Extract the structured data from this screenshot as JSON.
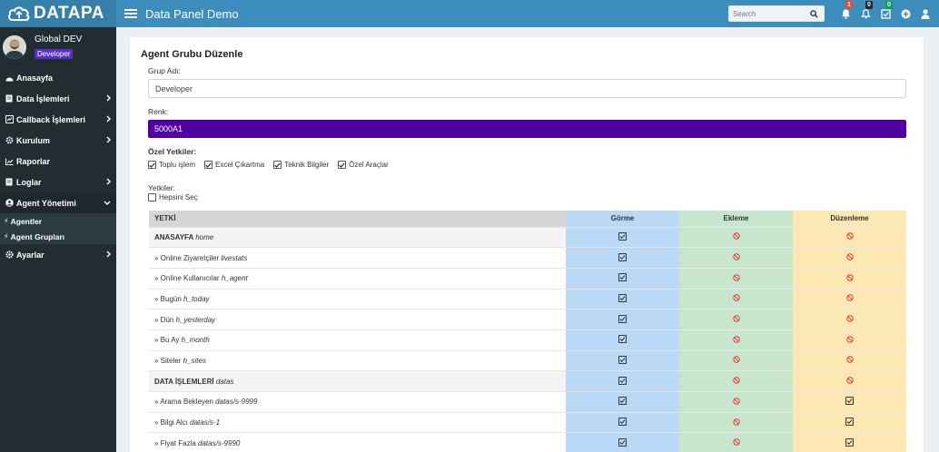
{
  "brand": {
    "logo_text": "DATAPA"
  },
  "header": {
    "title": "Data Panel Demo",
    "search_placeholder": "Search",
    "notifications_count": "1",
    "alerts_count": "0",
    "tasks_count": "0"
  },
  "user": {
    "name": "Global DEV",
    "role": "Developer"
  },
  "sidebar": {
    "items": [
      {
        "label": "Anasayfa"
      },
      {
        "label": "Data İşlemleri"
      },
      {
        "label": "Callback İşlemleri"
      },
      {
        "label": "Kurulum"
      },
      {
        "label": "Raporlar"
      },
      {
        "label": "Loglar"
      },
      {
        "label": "Agent Yönetimi"
      },
      {
        "label": "Ayarlar"
      }
    ],
    "subitems": [
      {
        "label": "Agentler"
      },
      {
        "label": "Agent Grupları"
      }
    ]
  },
  "form": {
    "title": "Agent Grubu Düzenle",
    "group_name_label": "Grup Adı:",
    "group_name_value": "Developer",
    "color_label": "Renk:",
    "color_value": "5000A1",
    "color_hex": "#5000a1",
    "special_label": "Özel Yetkiler:",
    "special_perms": [
      "Toplu işlem",
      "Excel Çıkartma",
      "Teknik Bilgiler",
      "Özel Araçlar"
    ],
    "perms_label": "Yetkiler:",
    "select_all_label": "Hepsini Seç"
  },
  "table": {
    "headers": [
      "YETKİ",
      "Görme",
      "Ekleme",
      "Düzenleme"
    ],
    "rows": [
      {
        "name": "ANASAYFA",
        "code": "home",
        "group": true,
        "view": "check",
        "add": "deny",
        "edit": "deny"
      },
      {
        "name": "» Online Ziyaretçiler",
        "code": "livestats",
        "view": "check",
        "add": "deny",
        "edit": "deny"
      },
      {
        "name": "» Online Kullanıcılar",
        "code": "h_agent",
        "view": "check",
        "add": "deny",
        "edit": "deny"
      },
      {
        "name": "» Bugün",
        "code": "h_today",
        "view": "check",
        "add": "deny",
        "edit": "deny"
      },
      {
        "name": "» Dün",
        "code": "h_yesterday",
        "view": "check",
        "add": "deny",
        "edit": "deny"
      },
      {
        "name": "» Bu Ay",
        "code": "h_month",
        "view": "check",
        "add": "deny",
        "edit": "deny"
      },
      {
        "name": "» Siteler",
        "code": "h_sites",
        "view": "check",
        "add": "deny",
        "edit": "deny"
      },
      {
        "name": "DATA İŞLEMLERİ",
        "code": "datas",
        "group": true,
        "view": "check",
        "add": "deny",
        "edit": "deny"
      },
      {
        "name": "» Arama Bekleyen",
        "code": "datas/s-9999",
        "view": "check",
        "add": "deny",
        "edit": "check"
      },
      {
        "name": "» Bilgi Alcı",
        "code": "datas/s-1",
        "view": "check",
        "add": "deny",
        "edit": "check"
      },
      {
        "name": "» Fiyat Fazla",
        "code": "datas/s-9990",
        "view": "check",
        "add": "deny",
        "edit": "check"
      }
    ]
  },
  "colors": {
    "navbar": "#3c8dbc",
    "logo_bg": "#367fa9",
    "sidebar": "#222d32",
    "view_col": "#b9d9f7",
    "add_col": "#c8e6cd",
    "edit_col": "#fde8b3",
    "deny_icon": "#e53935",
    "badge_red": "#dd4b39",
    "badge_green": "#00a65a"
  }
}
